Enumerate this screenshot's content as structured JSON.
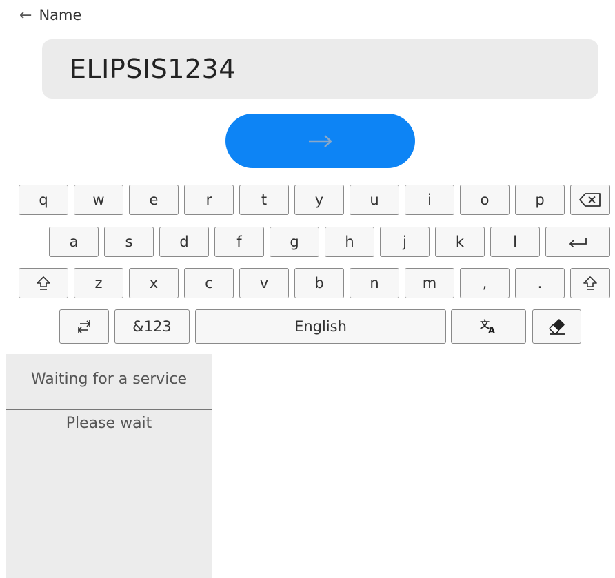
{
  "header": {
    "back_icon": "arrow-left-icon",
    "title": "Name"
  },
  "name_field": {
    "value": "ELIPSIS1234"
  },
  "submit_button": {
    "icon": "arrow-right-icon",
    "color": "#0d84f5"
  },
  "keyboard": {
    "row1": [
      "q",
      "w",
      "e",
      "r",
      "t",
      "y",
      "u",
      "i",
      "o",
      "p"
    ],
    "row2": [
      "a",
      "s",
      "d",
      "f",
      "g",
      "h",
      "j",
      "k",
      "l"
    ],
    "row3": [
      "z",
      "x",
      "c",
      "v",
      "b",
      "n",
      "m",
      ",",
      "."
    ],
    "symbols_label": "&123",
    "language_label": "English",
    "icons": {
      "backspace": "backspace-icon",
      "enter": "enter-icon",
      "shift": "shift-icon",
      "layout_switch": "keyboard-switch-icon",
      "translate": "translate-icon",
      "clear": "eraser-icon"
    }
  },
  "status_panel": {
    "title": "Waiting for a service",
    "message": "Please wait"
  }
}
